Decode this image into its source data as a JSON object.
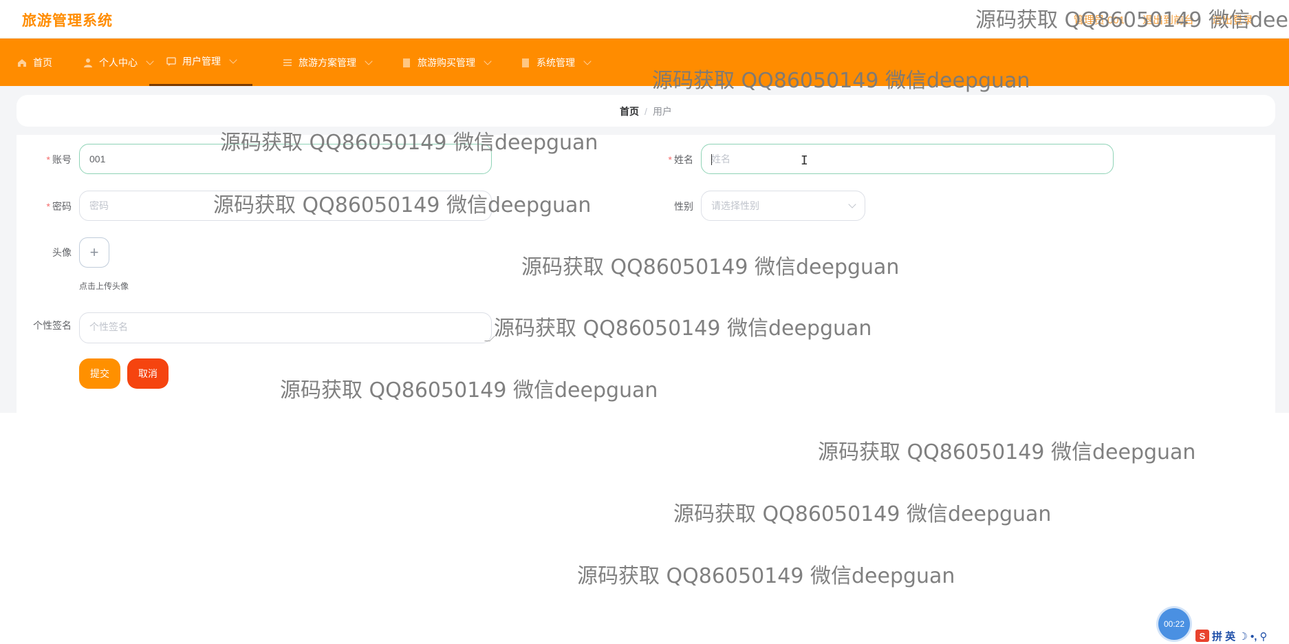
{
  "header": {
    "brand": "旅游管理系统",
    "top_links": [
      "管理员 001",
      "退出到前台",
      "退出登录"
    ]
  },
  "nav": {
    "items": [
      {
        "label": "首页",
        "icon": "home-icon"
      },
      {
        "label": "个人中心",
        "icon": "user-icon"
      },
      {
        "label": "用户管理",
        "icon": "chat-icon",
        "active": true
      },
      {
        "label": "旅游方案管理",
        "icon": "list-icon"
      },
      {
        "label": "旅游购买管理",
        "icon": "building-icon"
      },
      {
        "label": "系统管理",
        "icon": "building-icon"
      }
    ]
  },
  "breadcrumb": {
    "home": "首页",
    "separator": "/",
    "current": "用户"
  },
  "form": {
    "account_label": "账号",
    "account_value": "001",
    "name_label": "姓名",
    "name_placeholder": "姓名",
    "password_label": "密码",
    "password_placeholder": "密码",
    "gender_label": "性别",
    "gender_placeholder": "请选择性别",
    "avatar_label": "头像",
    "avatar_plus": "+",
    "avatar_hint": "点击上传头像",
    "signature_label": "个性签名",
    "signature_placeholder": "个性签名",
    "required_mark": "*",
    "submit_label": "提交",
    "cancel_label": "取消"
  },
  "watermark": {
    "text": "源码获取 QQ86050149 微信deepguan",
    "top_text": "源码获取 QQ86050149 微信deep"
  },
  "system": {
    "timer": "00:22",
    "ime_logo": "S",
    "ime_text": "拼 英 ☽ •, ⚲"
  },
  "colors": {
    "accent": "#ff8c00",
    "submit": "#ff9000",
    "cancel": "#f5440f"
  }
}
